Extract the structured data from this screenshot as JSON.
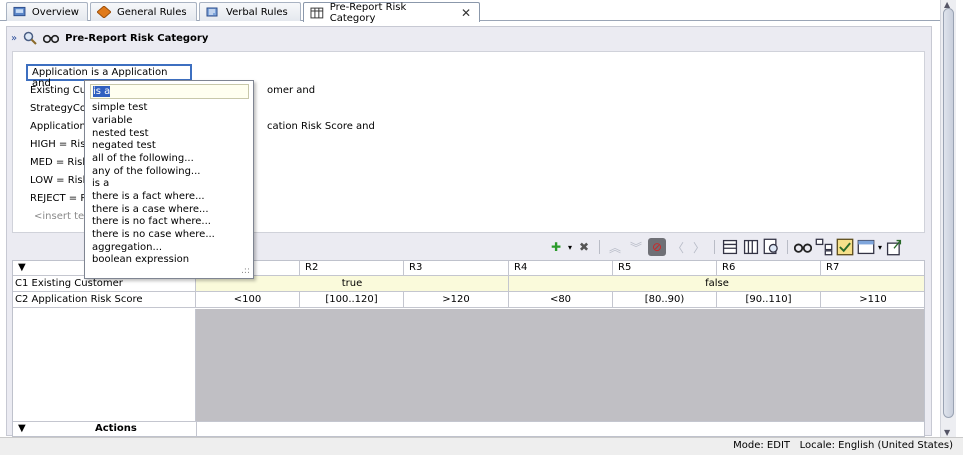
{
  "tabs": [
    {
      "label": "Overview",
      "icon": "overview-icon",
      "active": false
    },
    {
      "label": "General Rules",
      "icon": "diamond-icon",
      "active": false
    },
    {
      "label": "Verbal Rules",
      "icon": "verbal-rules-icon",
      "active": false
    },
    {
      "label": "Pre-Report Risk Category",
      "icon": "decision-table-icon",
      "active": true,
      "close": "✕"
    }
  ],
  "panel": {
    "title": "Pre-Report Risk Category",
    "icons": [
      "collapse-icon",
      "zoom-icon",
      "binoculars-icon"
    ]
  },
  "rules": {
    "lines": [
      "Application is a Application and",
      "Existing Cu",
      "omer and",
      "StrategyCo",
      "Application",
      "cation Risk Score and",
      "HIGH = Risk",
      "MED = Risk",
      "LOW = Risk",
      "REJECT = Ri",
      "<insert test"
    ]
  },
  "dropdown": {
    "input_value": "is a",
    "items": [
      "simple test",
      "variable",
      "nested test",
      "negated test",
      "all of the following...",
      "any of the following...",
      "is a",
      "there is a fact where...",
      "there is a case where...",
      "there is no fact where...",
      "there is no case where...",
      "aggregation...",
      "boolean expression"
    ],
    "grip": ".::"
  },
  "toolbar": {
    "add": "✚",
    "delete": "✖",
    "up": "︽",
    "down": "︾",
    "stop": "⊘",
    "prev": "〈",
    "next": "〉"
  },
  "grid": {
    "columns": [
      "R2",
      "R3",
      "R4",
      "R5",
      "R6",
      "R7"
    ],
    "header_arrow": "▼",
    "conditions": [
      {
        "label": "C1 Existing Customer",
        "values": [
          "true",
          "false"
        ]
      },
      {
        "label": "C2 Application Risk Score",
        "values": [
          "<100",
          "[100..120]",
          ">120",
          "<80",
          "[80..90)",
          "[90..110]",
          ">110"
        ]
      }
    ],
    "actions_label": "Actions",
    "actions_arrow": "▼"
  },
  "status": {
    "mode": "Mode: EDIT",
    "locale": "Locale: English (United States)"
  }
}
